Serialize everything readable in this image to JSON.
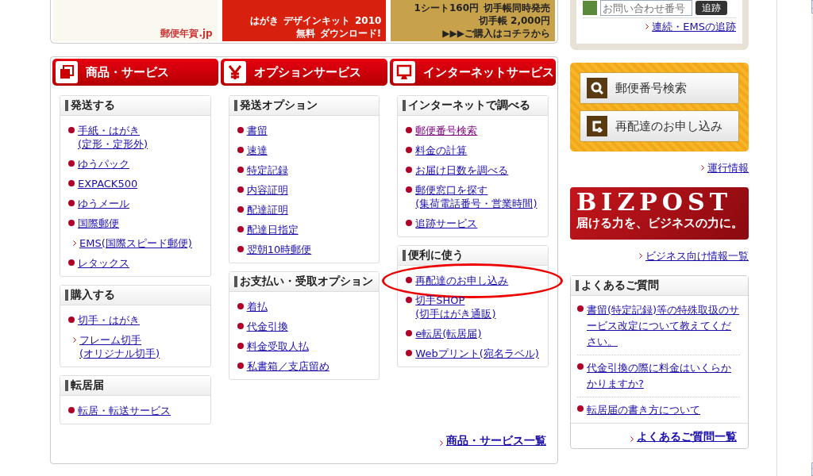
{
  "banners": [
    {
      "kind": "nenga",
      "texts": [
        "郵便年賀.jp"
      ]
    },
    {
      "kind": "kit",
      "texts": [
        "はがき",
        "デザインキット",
        "2010",
        "無料",
        "ダウンロード!"
      ]
    },
    {
      "kind": "stamp",
      "texts": [
        "1シート160円",
        "切手帳同時発売",
        "切手帳 2,000円",
        "▶▶▶ご購入はコチラから"
      ]
    }
  ],
  "tracking": {
    "placeholder": "お問い合わせ番号",
    "button": "追跡",
    "link": "連続・EMSの追跡"
  },
  "category_tabs": [
    {
      "kind": "goods",
      "label": "商品・サービス"
    },
    {
      "kind": "yen",
      "label": "オプションサービス"
    },
    {
      "kind": "monitor",
      "label": "インターネットサービス"
    }
  ],
  "columns": [
    [
      {
        "title": "発送する",
        "items": [
          {
            "kind": "bullet",
            "text": "手紙・はがき\n(定形・定形外)",
            "visited": false,
            "circled": false
          },
          {
            "kind": "bullet",
            "text": "ゆうパック",
            "visited": false,
            "circled": false
          },
          {
            "kind": "bullet",
            "text": "EXPACK500",
            "visited": false,
            "circled": false
          },
          {
            "kind": "bullet",
            "text": "ゆうメール",
            "visited": false,
            "circled": false
          },
          {
            "kind": "bullet",
            "text": "国際郵便",
            "visited": false,
            "circled": false
          },
          {
            "kind": "sub",
            "text": "EMS(国際スピード郵便)",
            "visited": false,
            "circled": false
          },
          {
            "kind": "bullet",
            "text": "レタックス",
            "visited": false,
            "circled": false
          }
        ]
      },
      {
        "title": "購入する",
        "items": [
          {
            "kind": "bullet",
            "text": "切手・はがき",
            "visited": false,
            "circled": false
          },
          {
            "kind": "sub",
            "text": "フレーム切手\n(オリジナル切手)",
            "visited": false,
            "circled": false
          }
        ]
      },
      {
        "title": "転居届",
        "items": [
          {
            "kind": "bullet",
            "text": "転居・転送サービス",
            "visited": false,
            "circled": false
          }
        ]
      }
    ],
    [
      {
        "title": "発送オプション",
        "items": [
          {
            "kind": "bullet",
            "text": "書留",
            "visited": false,
            "circled": false
          },
          {
            "kind": "bullet",
            "text": "速達",
            "visited": false,
            "circled": false
          },
          {
            "kind": "bullet",
            "text": "特定記録",
            "visited": false,
            "circled": false
          },
          {
            "kind": "bullet",
            "text": "内容証明",
            "visited": false,
            "circled": false
          },
          {
            "kind": "bullet",
            "text": "配達証明",
            "visited": false,
            "circled": false
          },
          {
            "kind": "bullet",
            "text": "配達日指定",
            "visited": false,
            "circled": false
          },
          {
            "kind": "bullet",
            "text": "翌朝10時郵便",
            "visited": false,
            "circled": false
          }
        ]
      },
      {
        "title": "お支払い・受取オプション",
        "items": [
          {
            "kind": "bullet",
            "text": "着払",
            "visited": false,
            "circled": false
          },
          {
            "kind": "bullet",
            "text": "代金引換",
            "visited": false,
            "circled": false
          },
          {
            "kind": "bullet",
            "text": "料金受取人払",
            "visited": false,
            "circled": false
          },
          {
            "kind": "bullet",
            "text": "私書箱／支店留め",
            "visited": false,
            "circled": false
          }
        ]
      }
    ],
    [
      {
        "title": "インターネットで調べる",
        "items": [
          {
            "kind": "bullet",
            "text": "郵便番号検索",
            "visited": true,
            "circled": false
          },
          {
            "kind": "bullet",
            "text": "料金の計算",
            "visited": false,
            "circled": false
          },
          {
            "kind": "bullet",
            "text": "お届け日数を調べる",
            "visited": false,
            "circled": false
          },
          {
            "kind": "bullet",
            "text": "郵便窓口を探す\n(集荷電話番号・営業時間)",
            "visited": false,
            "circled": false
          },
          {
            "kind": "bullet",
            "text": "追跡サービス",
            "visited": false,
            "circled": false
          }
        ]
      },
      {
        "title": "便利に使う",
        "items": [
          {
            "kind": "bullet",
            "text": "再配達のお申し込み",
            "visited": false,
            "circled": true
          },
          {
            "kind": "bullet",
            "text": "切手SHOP\n(切手はがき通販)",
            "visited": false,
            "circled": false
          },
          {
            "kind": "bullet",
            "text": "e転居(転居届)",
            "visited": false,
            "circled": false
          },
          {
            "kind": "bullet",
            "text": "Webプリント(宛名ラベル)",
            "visited": false,
            "circled": false
          }
        ]
      }
    ]
  ],
  "more_link": "商品・サービス一覧",
  "quick_buttons": [
    {
      "kind": "search",
      "label": "郵便番号検索"
    },
    {
      "kind": "redeliver",
      "label": "再配達のお申し込み"
    }
  ],
  "operation_link": "運行情報",
  "bizpost": {
    "title": "BIZPOST",
    "tagline": "届ける力を、ビジネスの力に。",
    "link": "ビジネス向け情報一覧"
  },
  "faq": {
    "title": "よくあるご質問",
    "items": [
      "書留(特定記録)等の特殊取扱のサービス改定について教えてください。",
      "代金引換の際に料金はいくらかかりますか?",
      "転居届の書き方について"
    ],
    "more": "よくあるご質問一覧"
  }
}
